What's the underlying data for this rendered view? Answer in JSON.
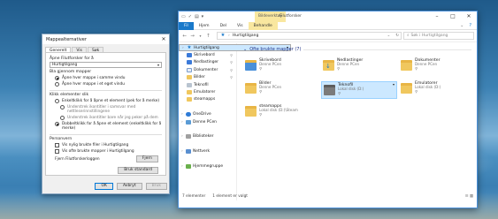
{
  "dialog": {
    "title": "Mappealternativer",
    "close": "✕",
    "tabs": [
      "Generelt",
      "Vis",
      "Søk"
    ],
    "open_label": "Åpne Filutforsker for å",
    "open_value": "Hurtigtilgang",
    "browse_label": "Bla gjennom mapper",
    "browse_opt1": "Åpne hver mappe i samme vindu",
    "browse_opt2": "Åpne hver mappe i et eget vindu",
    "click_label": "Klikk elementer slik",
    "click_opt1": "Enkeltklikk for å åpne et element (pek for å merke)",
    "click_sub1": "Understrek ikontitler i samsvar med nettleserinnstillingene",
    "click_sub2": "Understrek ikontitler bare når jeg peker på dem",
    "click_opt2": "Dobbeltklikk for å åpne et element (enkeltklikk for å merke)",
    "privacy_label": "Personvern",
    "privacy_chk1": "Vis nylig brukte filer i Hurtigtilgang",
    "privacy_chk2": "Vis ofte brukte mapper i Hurtigtilgang",
    "clear_label": "Fjern Filutforskerloggen",
    "clear_btn": "Fjern",
    "defaults_btn": "Bruk standard",
    "ok_btn": "OK",
    "cancel_btn": "Avbryt",
    "apply_btn": "Bruk"
  },
  "explorer": {
    "context_tab": "Bildeverktøy",
    "title": "Filutforsker",
    "ribbon_tabs": [
      "Fil",
      "Hjem",
      "Del",
      "Vis",
      "Behandle"
    ],
    "address": "Hurtigtilgang",
    "search_placeholder": "Søk i Hurtigtilgang",
    "group_header": "Ofte brukte mapper (7)",
    "status_count": "7 elementer",
    "status_selected": "1 element er valgt",
    "nav_items": [
      {
        "label": "Hurtigtilgang",
        "icon": "star",
        "selected": true
      },
      {
        "label": "Skrivebord",
        "icon": "blue",
        "pin": true
      },
      {
        "label": "Nedlastinger",
        "icon": "blue",
        "pin": true
      },
      {
        "label": "Dokumenter",
        "icon": "doc",
        "pin": true
      },
      {
        "label": "Bilder",
        "icon": "folder",
        "pin": true
      },
      {
        "label": "Teknofil",
        "icon": "drive"
      },
      {
        "label": "Emulatorer",
        "icon": "folder"
      },
      {
        "label": "steamapps",
        "icon": "folder"
      },
      {
        "label": "",
        "icon": ""
      },
      {
        "label": "OneDrive",
        "icon": "cloud"
      },
      {
        "label": "Denne PCen",
        "icon": "pc"
      },
      {
        "label": "",
        "icon": ""
      },
      {
        "label": "Biblioteker",
        "icon": "lib"
      },
      {
        "label": "",
        "icon": ""
      },
      {
        "label": "Nettverk",
        "icon": "net"
      },
      {
        "label": "",
        "icon": ""
      },
      {
        "label": "Hjemmegruppe",
        "icon": "home"
      }
    ],
    "tiles": [
      {
        "name": "Skrivebord",
        "sub": "Denne PCen",
        "icon": "desk"
      },
      {
        "name": "Nedlastinger",
        "sub": "Denne PCen",
        "icon": "dl"
      },
      {
        "name": "Dokumenter",
        "sub": "Denne PCen",
        "icon": "doc"
      },
      {
        "name": "Bilder",
        "sub": "Denne PCen",
        "icon": "img"
      },
      {
        "name": "Teknofil",
        "sub": "Lokal disk (D:)",
        "icon": "dark",
        "selected": true
      },
      {
        "name": "Emulatorer",
        "sub": "Lokal disk (D:)",
        "icon": "folder"
      },
      {
        "name": "steamapps",
        "sub": "Lokal disk (D:)\\Steam",
        "icon": "folder"
      }
    ]
  }
}
